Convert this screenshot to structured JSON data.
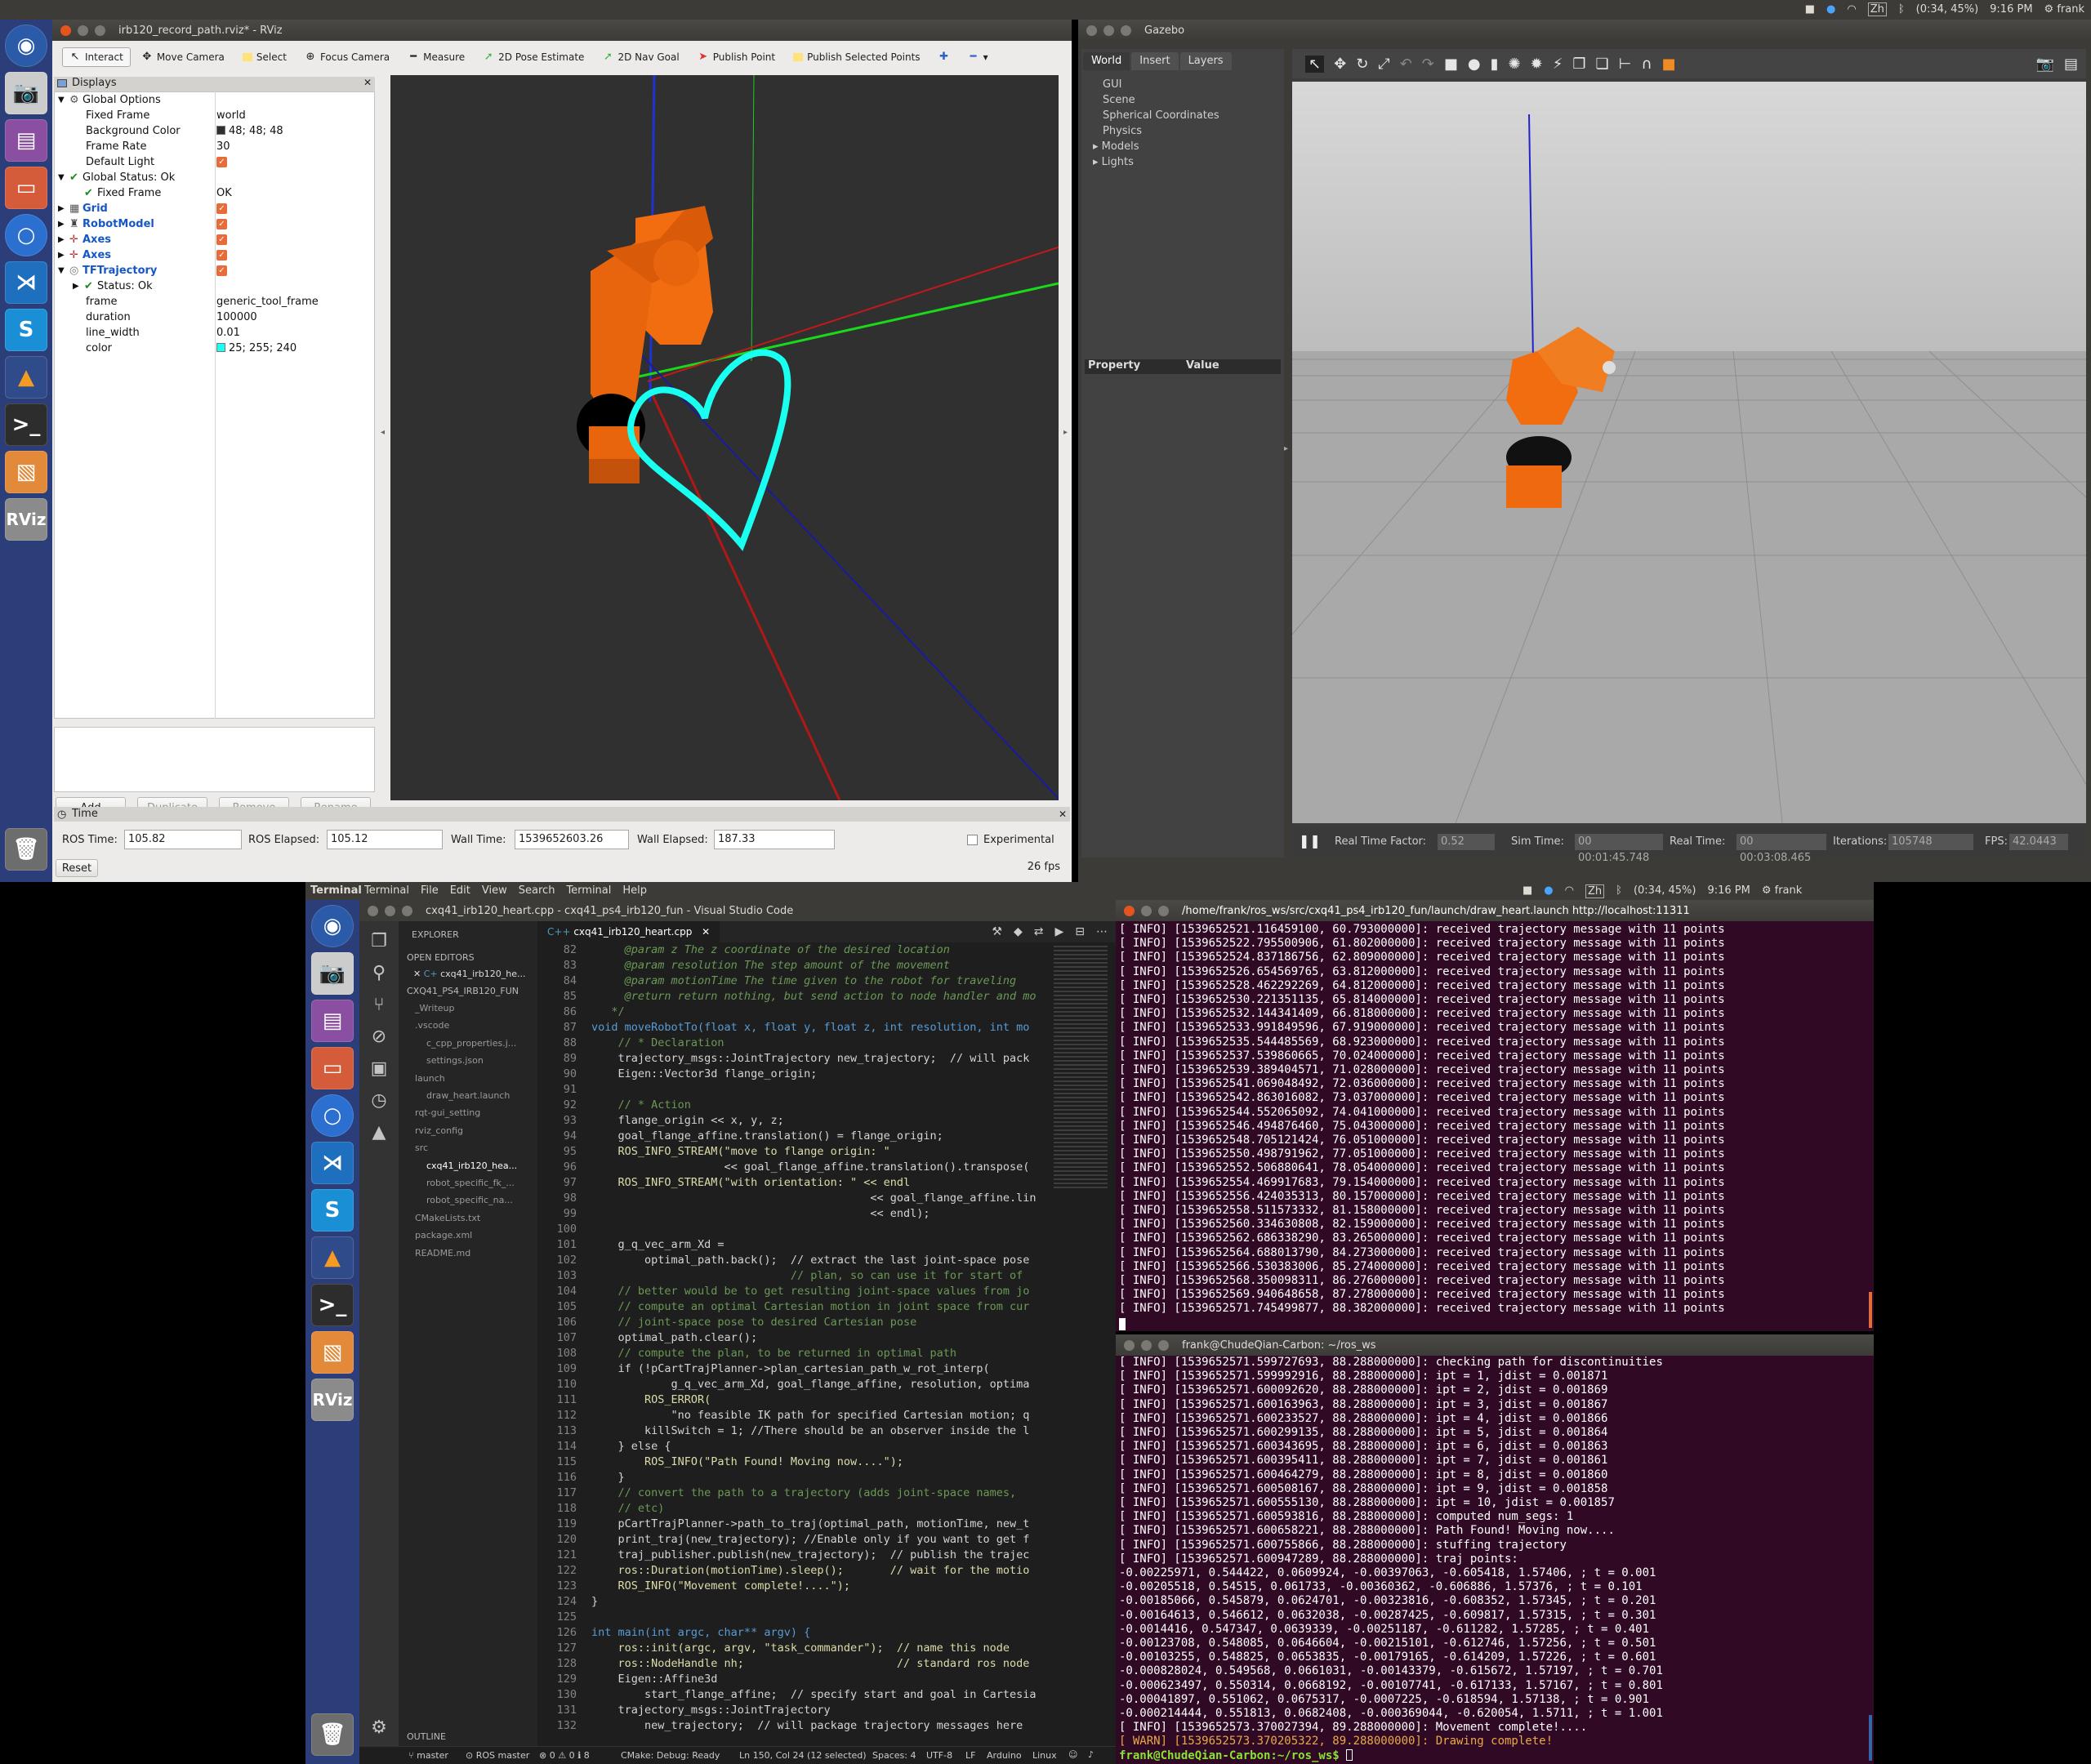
{
  "topbar": {
    "battery": "(0:34, 45%)",
    "time": "9:16 PM",
    "user": "frank",
    "ime": "Zh"
  },
  "rviz": {
    "title": "irb120_record_path.rviz* - RViz",
    "toolbar": [
      "Interact",
      "Move Camera",
      "Select",
      "Focus Camera",
      "Measure",
      "2D Pose Estimate",
      "2D Nav Goal",
      "Publish Point",
      "Publish Selected Points"
    ],
    "displays_title": "Displays",
    "tree": [
      {
        "k": "Global Options",
        "v": "",
        "depth": 1,
        "exp": "▼",
        "icon": "gear"
      },
      {
        "k": "Fixed Frame",
        "v": "world",
        "depth": 2
      },
      {
        "k": "Background Color",
        "v": "48; 48; 48",
        "depth": 2,
        "swatch": "#303030"
      },
      {
        "k": "Frame Rate",
        "v": "30",
        "depth": 2
      },
      {
        "k": "Default Light",
        "v": "",
        "depth": 2,
        "check": true
      },
      {
        "k": "Global Status: Ok",
        "v": "",
        "depth": 1,
        "exp": "▼",
        "icon": "ok"
      },
      {
        "k": "Fixed Frame",
        "v": "OK",
        "depth": 2,
        "icon": "ok"
      },
      {
        "k": "Grid",
        "v": "",
        "depth": 1,
        "exp": "▶",
        "blue": true,
        "check": true,
        "icon": "grid"
      },
      {
        "k": "RobotModel",
        "v": "",
        "depth": 1,
        "exp": "▶",
        "blue": true,
        "check": true,
        "icon": "robot"
      },
      {
        "k": "Axes",
        "v": "",
        "depth": 1,
        "exp": "▶",
        "blue": true,
        "check": true,
        "icon": "axes"
      },
      {
        "k": "Axes",
        "v": "",
        "depth": 1,
        "exp": "▶",
        "blue": true,
        "check": true,
        "icon": "axes"
      },
      {
        "k": "TFTrajectory",
        "v": "",
        "depth": 1,
        "exp": "▼",
        "blue": true,
        "check": true,
        "icon": "traj"
      },
      {
        "k": "Status: Ok",
        "v": "",
        "depth": 2,
        "exp": "▶",
        "icon": "ok"
      },
      {
        "k": "frame",
        "v": "generic_tool_frame",
        "depth": 2
      },
      {
        "k": "duration",
        "v": "100000",
        "depth": 2
      },
      {
        "k": "line_width",
        "v": "0.01",
        "depth": 2
      },
      {
        "k": "color",
        "v": "25; 255; 240",
        "depth": 2,
        "swatch": "#19fff0"
      }
    ],
    "buttons": {
      "add": "Add",
      "duplicate": "Duplicate",
      "remove": "Remove",
      "rename": "Rename"
    },
    "time": {
      "title": "Time",
      "ros_time_label": "ROS Time:",
      "ros_time": "105.82",
      "ros_elapsed_label": "ROS Elapsed:",
      "ros_elapsed": "105.12",
      "wall_time_label": "Wall Time:",
      "wall_time": "1539652603.26",
      "wall_elapsed_label": "Wall Elapsed:",
      "wall_elapsed": "187.33",
      "experimental": "Experimental",
      "reset": "Reset",
      "fps": "26 fps"
    }
  },
  "gazebo": {
    "title": "Gazebo",
    "tabs": [
      "World",
      "Insert",
      "Layers"
    ],
    "tree": [
      "GUI",
      "Scene",
      "Spherical Coordinates",
      "Physics",
      "Models",
      "Lights"
    ],
    "prop_header": {
      "property": "Property",
      "value": "Value"
    },
    "status": {
      "rtf_label": "Real Time Factor:",
      "rtf": "0.52",
      "sim_label": "Sim Time:",
      "sim": "00 00:01:45.748",
      "real_label": "Real Time:",
      "real": "00 00:03:08.465",
      "iter_label": "Iterations:",
      "iter": "105748",
      "fps_label": "FPS:",
      "fps": "42.0443"
    }
  },
  "topbar2": {
    "app": "Terminal",
    "menu": [
      "Terminal",
      "File",
      "Edit",
      "View",
      "Search",
      "Terminal",
      "Help"
    ],
    "battery": "(0:34, 45%)",
    "time": "9:16 PM",
    "user": "frank",
    "ime": "Zh"
  },
  "vscode": {
    "title": "cxq41_irb120_heart.cpp - cxq41_ps4_irb120_fun - Visual Studio Code",
    "explorer": "EXPLORER",
    "open_editors": "OPEN EDITORS",
    "open_file": "cxq41_irb120_he...",
    "project": "CXQ41_PS4_IRB120_FUN",
    "files": [
      {
        "n": "_Writeup",
        "d": 1
      },
      {
        "n": ".vscode",
        "d": 1
      },
      {
        "n": "c_cpp_properties.j...",
        "d": 2
      },
      {
        "n": "settings.json",
        "d": 2
      },
      {
        "n": "launch",
        "d": 1
      },
      {
        "n": "draw_heart.launch",
        "d": 2
      },
      {
        "n": "rqt-gui_setting",
        "d": 1
      },
      {
        "n": "rviz_config",
        "d": 1
      },
      {
        "n": "src",
        "d": 1
      },
      {
        "n": "cxq41_irb120_hea...",
        "d": 2
      },
      {
        "n": "robot_specific_fk_...",
        "d": 2
      },
      {
        "n": "robot_specific_na...",
        "d": 2
      },
      {
        "n": "CMakeLists.txt",
        "d": 1
      },
      {
        "n": "package.xml",
        "d": 1
      },
      {
        "n": "README.md",
        "d": 1
      }
    ],
    "outline": "OUTLINE",
    "tab": "cxq41_irb120_heart.cpp",
    "code": [
      [
        "82",
        "     @param z The z coordinate of the desired location"
      ],
      [
        "83",
        "     @param resolution The step amount of the movement"
      ],
      [
        "84",
        "     @param motionTime The time given to the robot for traveling"
      ],
      [
        "85",
        "     @return return nothing, but send action to node handler and mo"
      ],
      [
        "86",
        "   */"
      ],
      [
        "87",
        "void moveRobotTo(float x, float y, float z, int resolution, int mo"
      ],
      [
        "88",
        "    // * Declaration"
      ],
      [
        "89",
        "    trajectory_msgs::JointTrajectory new_trajectory;  // will pack"
      ],
      [
        "90",
        "    Eigen::Vector3d flange_origin;"
      ],
      [
        "91",
        ""
      ],
      [
        "92",
        "    // * Action"
      ],
      [
        "93",
        "    flange_origin << x, y, z;"
      ],
      [
        "94",
        "    goal_flange_affine.translation() = flange_origin;"
      ],
      [
        "95",
        "    ROS_INFO_STREAM(\"move to flange origin: \""
      ],
      [
        "96",
        "                    << goal_flange_affine.translation().transpose("
      ],
      [
        "97",
        "    ROS_INFO_STREAM(\"with orientation: \" << endl"
      ],
      [
        "98",
        "                                          << goal_flange_affine.lin"
      ],
      [
        "99",
        "                                          << endl);"
      ],
      [
        "100",
        ""
      ],
      [
        "101",
        "    g_q_vec_arm_Xd ="
      ],
      [
        "102",
        "        optimal_path.back();  // extract the last joint-space pose"
      ],
      [
        "103",
        "                              // plan, so can use it for start of"
      ],
      [
        "104",
        "    // better would be to get resulting joint-space values from jo"
      ],
      [
        "105",
        "    // compute an optimal Cartesian motion in joint space from cur"
      ],
      [
        "106",
        "    // joint-space pose to desired Cartesian pose"
      ],
      [
        "107",
        "    optimal_path.clear();"
      ],
      [
        "108",
        "    // compute the plan, to be returned in optimal path"
      ],
      [
        "109",
        "    if (!pCartTrajPlanner->plan_cartesian_path_w_rot_interp("
      ],
      [
        "110",
        "            g_q_vec_arm_Xd, goal_flange_affine, resolution, optima"
      ],
      [
        "111",
        "        ROS_ERROR("
      ],
      [
        "112",
        "            \"no feasible IK path for specified Cartesian motion; q"
      ],
      [
        "113",
        "        killSwitch = 1; //There should be an observer inside the l"
      ],
      [
        "114",
        "    } else {"
      ],
      [
        "115",
        "        ROS_INFO(\"Path Found! Moving now....\");"
      ],
      [
        "116",
        "    }"
      ],
      [
        "117",
        "    // convert the path to a trajectory (adds joint-space names,"
      ],
      [
        "118",
        "    // etc)"
      ],
      [
        "119",
        "    pCartTrajPlanner->path_to_traj(optimal_path, motionTime, new_t"
      ],
      [
        "120",
        "    print_traj(new_trajectory); //Enable only if you want to get f"
      ],
      [
        "121",
        "    traj_publisher.publish(new_trajectory);  // publish the trajec"
      ],
      [
        "122",
        "    ros::Duration(motionTime).sleep();       // wait for the motio"
      ],
      [
        "123",
        "    ROS_INFO(\"Movement complete!....\");"
      ],
      [
        "124",
        "}"
      ],
      [
        "125",
        ""
      ],
      [
        "126",
        "int main(int argc, char** argv) {"
      ],
      [
        "127",
        "    ros::init(argc, argv, \"task_commander\");  // name this node"
      ],
      [
        "128",
        "    ros::NodeHandle nh;                       // standard ros node"
      ],
      [
        "129",
        "    Eigen::Affine3d"
      ],
      [
        "130",
        "        start_flange_affine;  // specify start and goal in Cartesia"
      ],
      [
        "131",
        "    trajectory_msgs::JointTrajectory"
      ],
      [
        "132",
        "        new_trajectory;  // will package trajectory messages here"
      ]
    ],
    "status": {
      "branch": "master",
      "ros": "ROS master",
      "problems": "0 ⚠ 0 ℹ 8",
      "cmake": "CMake: Debug: Ready",
      "pos": "Ln 150, Col 24 (12 selected)",
      "spaces": "Spaces: 4",
      "enc": "UTF-8",
      "eol": "LF",
      "arduino": "Arduino",
      "lang": "Linux"
    }
  },
  "term1": {
    "title": "/home/frank/ros_ws/src/cxq41_ps4_irb120_fun/launch/draw_heart.launch http://localhost:11311",
    "lines": [
      "[ INFO] [1539652521.116459100, 60.793000000]: received trajectory message with 11 points",
      "[ INFO] [1539652522.795500906, 61.802000000]: received trajectory message with 11 points",
      "[ INFO] [1539652524.837186756, 62.809000000]: received trajectory message with 11 points",
      "[ INFO] [1539652526.654569765, 63.812000000]: received trajectory message with 11 points",
      "[ INFO] [1539652528.462292269, 64.812000000]: received trajectory message with 11 points",
      "[ INFO] [1539652530.221351135, 65.814000000]: received trajectory message with 11 points",
      "[ INFO] [1539652532.144341409, 66.818000000]: received trajectory message with 11 points",
      "[ INFO] [1539652533.991849596, 67.919000000]: received trajectory message with 11 points",
      "[ INFO] [1539652535.544485569, 68.923000000]: received trajectory message with 11 points",
      "[ INFO] [1539652537.539860665, 70.024000000]: received trajectory message with 11 points",
      "[ INFO] [1539652539.389404571, 71.028000000]: received trajectory message with 11 points",
      "[ INFO] [1539652541.069048492, 72.036000000]: received trajectory message with 11 points",
      "[ INFO] [1539652542.863016082, 73.037000000]: received trajectory message with 11 points",
      "[ INFO] [1539652544.552065092, 74.041000000]: received trajectory message with 11 points",
      "[ INFO] [1539652546.494876460, 75.043000000]: received trajectory message with 11 points",
      "[ INFO] [1539652548.705121424, 76.051000000]: received trajectory message with 11 points",
      "[ INFO] [1539652550.498791962, 77.051000000]: received trajectory message with 11 points",
      "[ INFO] [1539652552.506880641, 78.054000000]: received trajectory message with 11 points",
      "[ INFO] [1539652554.469917683, 79.154000000]: received trajectory message with 11 points",
      "[ INFO] [1539652556.424035313, 80.157000000]: received trajectory message with 11 points",
      "[ INFO] [1539652558.511573332, 81.158000000]: received trajectory message with 11 points",
      "[ INFO] [1539652560.334630808, 82.159000000]: received trajectory message with 11 points",
      "[ INFO] [1539652562.686338290, 83.265000000]: received trajectory message with 11 points",
      "[ INFO] [1539652564.688013790, 84.273000000]: received trajectory message with 11 points",
      "[ INFO] [1539652566.530383006, 85.274000000]: received trajectory message with 11 points",
      "[ INFO] [1539652568.350098311, 86.276000000]: received trajectory message with 11 points",
      "[ INFO] [1539652569.940648658, 87.278000000]: received trajectory message with 11 points",
      "[ INFO] [1539652571.745499877, 88.382000000]: received trajectory message with 11 points"
    ]
  },
  "term2": {
    "title": "frank@ChudeQian-Carbon: ~/ros_ws",
    "lines": [
      "[ INFO] [1539652571.599727693, 88.288000000]: checking path for discontinuities",
      "[ INFO] [1539652571.599992916, 88.288000000]: ipt = 1, jdist = 0.001871",
      "[ INFO] [1539652571.600092620, 88.288000000]: ipt = 2, jdist = 0.001869",
      "[ INFO] [1539652571.600163963, 88.288000000]: ipt = 3, jdist = 0.001867",
      "[ INFO] [1539652571.600233527, 88.288000000]: ipt = 4, jdist = 0.001866",
      "[ INFO] [1539652571.600299135, 88.288000000]: ipt = 5, jdist = 0.001864",
      "[ INFO] [1539652571.600343695, 88.288000000]: ipt = 6, jdist = 0.001863",
      "[ INFO] [1539652571.600395411, 88.288000000]: ipt = 7, jdist = 0.001861",
      "[ INFO] [1539652571.600464279, 88.288000000]: ipt = 8, jdist = 0.001860",
      "[ INFO] [1539652571.600508167, 88.288000000]: ipt = 9, jdist = 0.001858",
      "[ INFO] [1539652571.600555130, 88.288000000]: ipt = 10, jdist = 0.001857",
      "[ INFO] [1539652571.600593816, 88.288000000]: computed num_segs: 1",
      "[ INFO] [1539652571.600658221, 88.288000000]: Path Found! Moving now....",
      "[ INFO] [1539652571.600755866, 88.288000000]: stuffing trajectory",
      "[ INFO] [1539652571.600947289, 88.288000000]: traj points:",
      "-0.00225971, 0.544422, 0.0609924, -0.00397063, -0.605418, 1.57406, ; t = 0.001",
      "-0.00205518, 0.54515, 0.061733, -0.00360362, -0.606886, 1.57376, ; t = 0.101",
      "-0.00185066, 0.545879, 0.0624701, -0.00323816, -0.608352, 1.57345, ; t = 0.201",
      "-0.00164613, 0.546612, 0.0632038, -0.00287425, -0.609817, 1.57315, ; t = 0.301",
      "-0.0014416, 0.547347, 0.0639339, -0.00251187, -0.611282, 1.57285, ; t = 0.401",
      "-0.00123708, 0.548085, 0.0646604, -0.00215101, -0.612746, 1.57256, ; t = 0.501",
      "-0.00103255, 0.548825, 0.0653835, -0.00179165, -0.614209, 1.57226, ; t = 0.601",
      "-0.000828024, 0.549568, 0.0661031, -0.00143379, -0.615672, 1.57197, ; t = 0.701",
      "-0.000623497, 0.550314, 0.0668192, -0.00107741, -0.617133, 1.57167, ; t = 0.801",
      "-0.00041897, 0.551062, 0.0675317, -0.0007225, -0.618594, 1.57138, ; t = 0.901",
      "-0.000214444, 0.551813, 0.0682408, -0.000369044, -0.620054, 1.5711, ; t = 1.001",
      "[ INFO] [1539652573.370027394, 89.288000000]: Movement complete!....",
      "[ WARN] [1539652573.370205322, 89.288000000]: Drawing complete!"
    ],
    "prompt": "frank@ChudeQian-Carbon:~/ros_ws$"
  }
}
